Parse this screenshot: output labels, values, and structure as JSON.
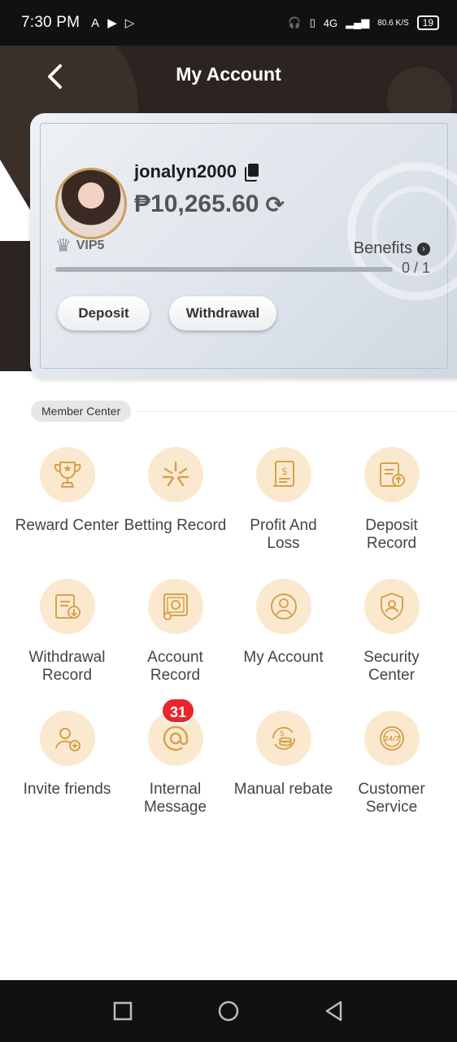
{
  "status_bar": {
    "time": "7:30 PM",
    "app_icons": [
      "A",
      "▶",
      "▷"
    ],
    "network": "4G",
    "speed": "80.6 K/S",
    "battery": "19"
  },
  "header": {
    "title": "My Account"
  },
  "account": {
    "username": "jonalyn2000",
    "balance": "₱10,265.60",
    "vip_level": "VIP5",
    "benefits_label": "Benefits",
    "progress_text": "0 / 1",
    "progress_fraction": 0,
    "deposit_label": "Deposit",
    "withdrawal_label": "Withdrawal"
  },
  "member_center": {
    "label": "Member Center",
    "items": [
      {
        "label": "Reward Center",
        "icon": "trophy-icon"
      },
      {
        "label": "Betting Record",
        "icon": "betting-icon"
      },
      {
        "label": "Profit And\nLoss",
        "icon": "profit-loss-icon"
      },
      {
        "label": "Deposit\nRecord",
        "icon": "deposit-record-icon"
      },
      {
        "label": "Withdrawal\nRecord",
        "icon": "withdrawal-record-icon"
      },
      {
        "label": "Account\nRecord",
        "icon": "account-record-icon"
      },
      {
        "label": "My Account",
        "icon": "user-icon"
      },
      {
        "label": "Security\nCenter",
        "icon": "shield-icon"
      },
      {
        "label": "Invite friends",
        "icon": "invite-icon"
      },
      {
        "label": "Internal\nMessage",
        "icon": "at-icon"
      },
      {
        "label": "Manual rebate",
        "icon": "rebate-icon"
      },
      {
        "label": "Customer\nService",
        "icon": "support-24-7-icon"
      }
    ],
    "message_badge": "31"
  },
  "colors": {
    "accent_icon": "#d6a24e",
    "icon_bg": "#fbe9cf",
    "header_bg": "#2b2420",
    "badge": "#e8262b"
  }
}
